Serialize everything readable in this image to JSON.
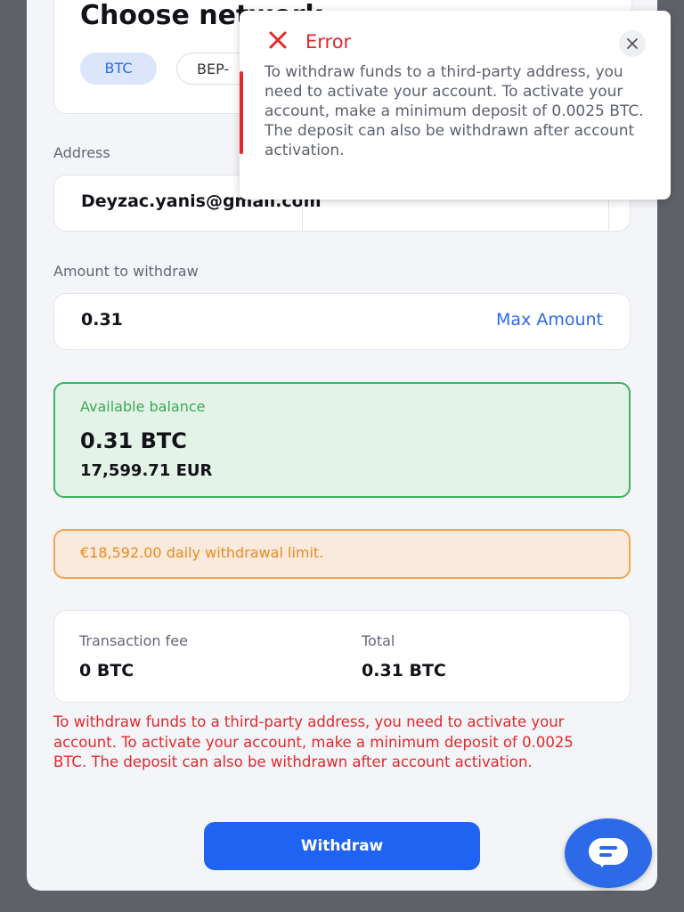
{
  "network": {
    "title": "Choose network",
    "chips": [
      "BTC",
      "BEP-"
    ],
    "selected": "BTC"
  },
  "address": {
    "label": "Address",
    "value": "Deyzac.yanis@gmail.com"
  },
  "amount": {
    "label": "Amount to withdraw",
    "value": "0.31",
    "max_label": "Max Amount"
  },
  "balance": {
    "label": "Available balance",
    "btc": "0.31 BTC",
    "eur": "17,599.71 EUR"
  },
  "limit": {
    "text": "€18,592.00 daily withdrawal limit."
  },
  "fees": {
    "fee_label": "Transaction fee",
    "fee_value": "0 BTC",
    "total_label": "Total",
    "total_value": "0.31 BTC"
  },
  "error_message": "To withdraw funds to a third-party address, you need to activate your account. To activate your account, make a minimum deposit of 0.0025 BTC. The deposit can also be withdrawn after account activation.",
  "withdraw_label": "Withdraw",
  "toast": {
    "title": "Error",
    "body": "To withdraw funds to a third-party address, you need to activate your account. To activate your account, make a minimum deposit of 0.0025 BTC. The deposit can also be withdrawn after account activation."
  },
  "colors": {
    "accent": "#1f63f2",
    "error": "#e3282c",
    "success": "#3cb55c",
    "warning": "#f4a64a"
  },
  "icons": {
    "toast_icon": "error-x-icon",
    "close": "close-icon",
    "chat": "chat-icon"
  }
}
